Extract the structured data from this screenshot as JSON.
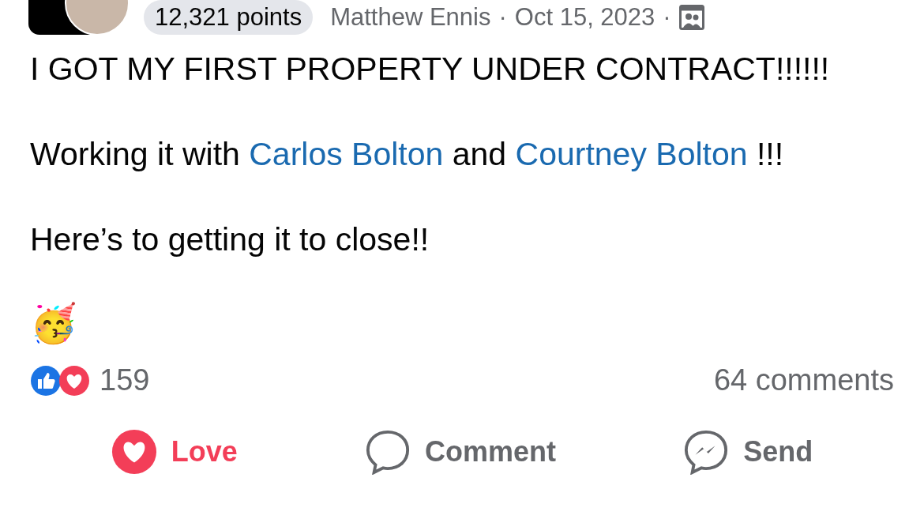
{
  "header": {
    "points": "12,321 points",
    "author": "Matthew Ennis",
    "separator_1": "·",
    "date": "Oct 15, 2023",
    "separator_2": "·"
  },
  "post": {
    "paragraphs": [
      [
        {
          "kind": "text",
          "text": "I GOT MY FIRST PROPERTY UNDER CONTRACT!!!!!!"
        }
      ],
      [
        {
          "kind": "text",
          "text": "Working it with "
        },
        {
          "kind": "link",
          "text": "Carlos Bolton"
        },
        {
          "kind": "text",
          "text": " and "
        },
        {
          "kind": "link",
          "text": "Courtney Bolton"
        },
        {
          "kind": "text",
          "text": " !!!"
        }
      ],
      [
        {
          "kind": "text",
          "text": "Here’s to getting it to close!!"
        }
      ]
    ],
    "emoji": "🥳"
  },
  "reactions": {
    "count": "159",
    "comments": "64 comments"
  },
  "actions": [
    {
      "kind": "love",
      "label": "Love",
      "selected": true
    },
    {
      "kind": "comment",
      "label": "Comment",
      "selected": false
    },
    {
      "kind": "send",
      "label": "Send",
      "selected": false
    }
  ]
}
